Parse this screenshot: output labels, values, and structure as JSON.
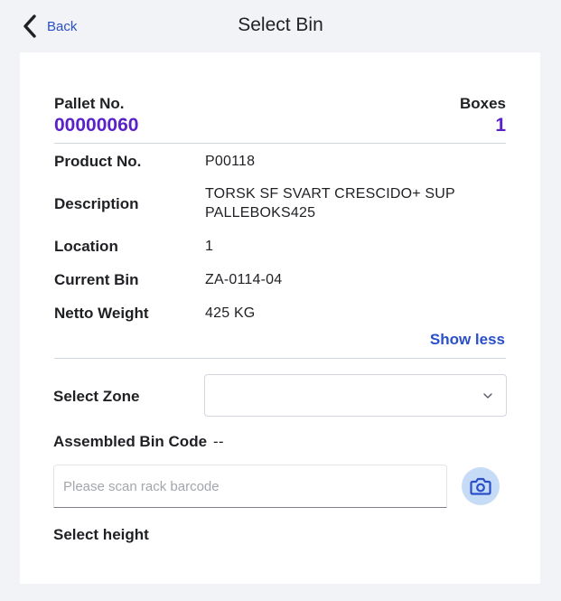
{
  "header": {
    "back_label": "Back",
    "title": "Select Bin"
  },
  "pallet": {
    "pallet_label": "Pallet No.",
    "pallet_value": "00000060",
    "boxes_label": "Boxes",
    "boxes_value": "1"
  },
  "details": {
    "product_label": "Product No.",
    "product_value": "P00118",
    "description_label": "Description",
    "description_line1": "TORSK SF SVART CRESCIDO+ SUP",
    "description_line2": "PALLEBOKS425",
    "location_label": "Location",
    "location_value": "1",
    "current_bin_label": "Current Bin",
    "current_bin_value": "ZA-0114-04",
    "netto_label": "Netto Weight",
    "netto_value": "425 KG"
  },
  "show_less_label": "Show less",
  "form": {
    "zone_label": "Select Zone",
    "zone_value": "",
    "assembled_label": "Assembled Bin Code",
    "assembled_value": "--",
    "scan_placeholder": "Please scan rack barcode",
    "height_label": "Select height"
  },
  "icons": {
    "back": "chevron-left-icon",
    "dropdown": "chevron-down-icon",
    "camera": "camera-icon"
  },
  "colors": {
    "accent_purple": "#5a22c9",
    "link_blue": "#2a4fc9",
    "background": "#f1f3f6",
    "camera_button": "#c6dbf5"
  }
}
